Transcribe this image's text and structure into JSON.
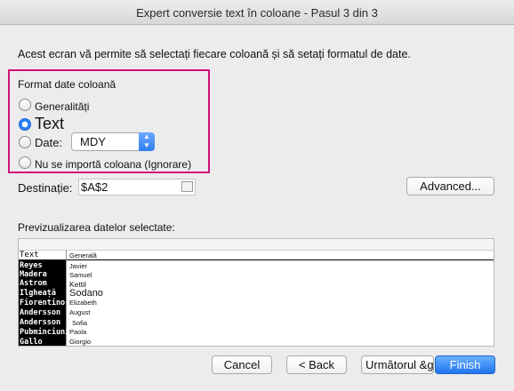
{
  "window": {
    "title": "Expert conversie text în coloane - Pasul 3 din 3"
  },
  "intro": "Acest ecran vă permite să selectați fiecare coloană și să setați formatul de date.",
  "format_group": {
    "label": "Format date coloană",
    "options": [
      {
        "label": "Generalități",
        "checked": false
      },
      {
        "label": "Text",
        "checked": true
      },
      {
        "label": "Date:",
        "checked": false
      },
      {
        "label": "Nu se importă coloana (Ignorare)",
        "checked": false
      }
    ],
    "date_select": "MDY"
  },
  "destination": {
    "label": "Destinație:",
    "value": "$A$2"
  },
  "buttons": {
    "advanced": "Advanced...",
    "cancel": "Cancel",
    "back": "< Back",
    "next": "Următorul &gt;",
    "finish": "Finish"
  },
  "preview": {
    "label": "Previzualizarea datelor selectate:",
    "headers": [
      "Text",
      "Generală"
    ],
    "rows": [
      [
        "Reyes",
        "Javier"
      ],
      [
        "Madera",
        "Samuel"
      ],
      [
        "Astrom",
        "Kettil"
      ],
      [
        "Ilgheață",
        "Sodano"
      ],
      [
        "Fiorentino",
        "Elizabeth"
      ],
      [
        "Andersson",
        "August"
      ],
      [
        "Andersson",
        "Sofia"
      ],
      [
        "Pubminciuni",
        "Paola"
      ],
      [
        "Gallo",
        "Giorgio"
      ]
    ]
  },
  "colors": {
    "highlight": "#d0117c",
    "accent": "#2d7ff9"
  }
}
